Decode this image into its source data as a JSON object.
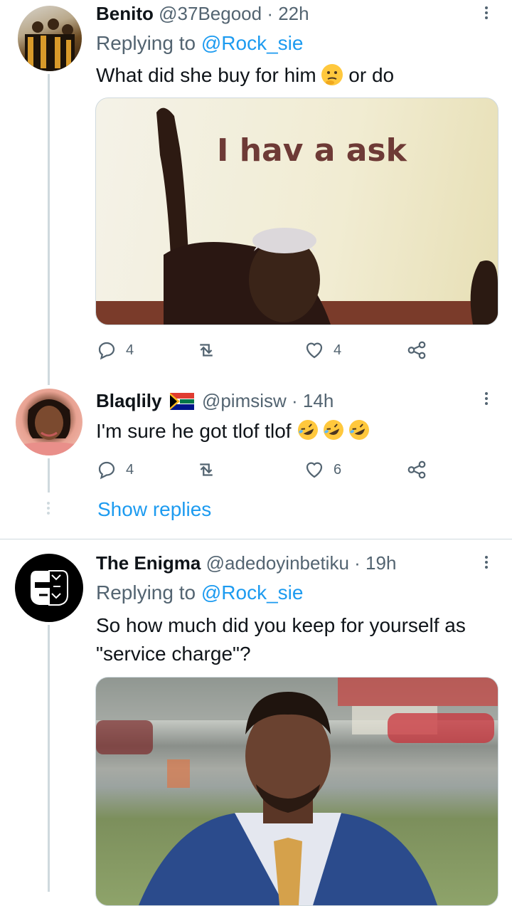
{
  "tweets": [
    {
      "name": "Benito",
      "handle": "@37Begood",
      "time": "· 22h",
      "replying_prefix": "Replying to ",
      "replying_to": "@Rock_sie",
      "text_before": "What did she buy for him",
      "emoji": "thinking-face",
      "text_after": "or do",
      "image_caption": "I hav a ask",
      "replies": "4",
      "likes": "4"
    },
    {
      "name": "Blaqlily",
      "flag": "south-africa-flag",
      "handle": "@pimsisw",
      "time": "· 14h",
      "text": "I'm sure he got tlof tlof",
      "emoji": "rolling-on-floor-laughing x3",
      "replies": "4",
      "likes": "6",
      "show_replies": "Show replies"
    },
    {
      "name": "The Enigma",
      "handle": "@adedoyinbetiku",
      "time": "· 19h",
      "replying_prefix": "Replying to ",
      "replying_to": "@Rock_sie",
      "text_line1": "So how much did you keep for yourself as",
      "text_line2": "\"service charge\"?"
    }
  ],
  "colors": {
    "link": "#1d9bf0",
    "secondary": "#536471",
    "line": "#cfd9de",
    "emoji": "#ffc83d"
  }
}
